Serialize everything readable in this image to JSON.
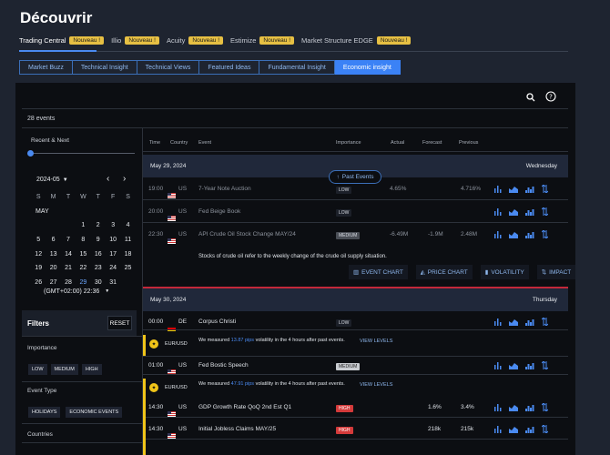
{
  "page": {
    "title": "Découvrir"
  },
  "topnav": [
    {
      "label": "Trading Central",
      "badge": "Nouveau !",
      "active": true
    },
    {
      "label": "Illio",
      "badge": "Nouveau !"
    },
    {
      "label": "Acuity",
      "badge": "Nouveau !"
    },
    {
      "label": "Estimize",
      "badge": "Nouveau !"
    },
    {
      "label": "Market Structure EDGE",
      "badge": "Nouveau !"
    }
  ],
  "subtabs": [
    "Market Buzz",
    "Technical Insight",
    "Technical Views",
    "Featured Ideas",
    "Fundamental Insight",
    "Economic insight"
  ],
  "events_count": "28 events",
  "sidebar": {
    "range_label": "Recent & Next",
    "month_label": "2024-05",
    "month_name": "MAY",
    "weekdays": [
      "S",
      "M",
      "T",
      "W",
      "T",
      "F",
      "S"
    ],
    "weeks": [
      [
        "",
        "",
        "",
        "1",
        "2",
        "3",
        "4"
      ],
      [
        "5",
        "6",
        "7",
        "8",
        "9",
        "10",
        "11"
      ],
      [
        "12",
        "13",
        "14",
        "15",
        "16",
        "17",
        "18"
      ],
      [
        "19",
        "20",
        "21",
        "22",
        "23",
        "24",
        "25"
      ],
      [
        "26",
        "27",
        "28",
        "29",
        "30",
        "31",
        ""
      ]
    ],
    "today": "29",
    "timezone": "(GMT+02:00) 22:36",
    "filters_title": "Filters",
    "reset_label": "RESET",
    "importance_label": "Importance",
    "importance_options": [
      "LOW",
      "MEDIUM",
      "HIGH"
    ],
    "event_type_label": "Event Type",
    "event_type_options": [
      "HOLIDAYS",
      "ECONOMIC EVENTS"
    ],
    "countries_label": "Countries"
  },
  "table": {
    "columns": [
      "Time",
      "Country",
      "Event",
      "Importance",
      "Actual",
      "Forecast",
      "Previous"
    ],
    "past_events_label": "Past Events",
    "day1": {
      "date": "May 29, 2024",
      "weekday": "Wednesday"
    },
    "day2": {
      "date": "May 30, 2024",
      "weekday": "Thursday"
    },
    "rows1": [
      {
        "time": "19:00",
        "country": "US",
        "event": "7-Year Note Auction",
        "importance": "LOW",
        "actual": "4.65%",
        "forecast": "",
        "previous": "4.716%",
        "dim": true
      },
      {
        "time": "20:00",
        "country": "US",
        "event": "Fed Beige Book",
        "importance": "LOW",
        "actual": "",
        "forecast": "",
        "previous": "",
        "dim": true
      },
      {
        "time": "22:30",
        "country": "US",
        "event": "API Crude Oil Stock Change MAY/24",
        "importance": "MEDIUM",
        "actual": "-6.49M",
        "forecast": "-1.9M",
        "previous": "2.48M",
        "dim": true
      }
    ],
    "expanded_text": "Stocks of crude oil refer to the weekly change of the crude oil supply situation.",
    "expanded_actions": [
      "EVENT CHART",
      "PRICE CHART",
      "VOLATILITY",
      "IMPACT"
    ],
    "rows2": [
      {
        "time": "00:00",
        "country": "DE",
        "event": "Corpus Christi",
        "importance": "LOW"
      },
      {
        "time": "01:00",
        "country": "US",
        "event": "Fed Bostic Speech",
        "importance": "MEDIUM"
      },
      {
        "time": "14:30",
        "country": "US",
        "event": "GDP Growth Rate QoQ 2nd Est Q1",
        "importance": "HIGH",
        "actual": "",
        "forecast": "1.6%",
        "previous": "3.4%"
      },
      {
        "time": "14:30",
        "country": "US",
        "event": "Initial Jobless Claims MAY/25",
        "importance": "HIGH",
        "actual": "",
        "forecast": "218k",
        "previous": "215k"
      }
    ],
    "notif1": {
      "pair": "EUR/USD",
      "pre": "We measured ",
      "pips": "13.87 pips",
      "post": " volatility in the 4 hours after past events.",
      "action": "VIEW LEVELS"
    },
    "notif2": {
      "pair": "EUR/USD",
      "pre": "We measured ",
      "pips": "47.91 pips",
      "post": " volatility in the 4 hours after past events.",
      "action": "VIEW LEVELS"
    }
  },
  "colors": {
    "accent": "#3b82f6",
    "badge": "#e7c043",
    "high": "#d43a3a",
    "highlight": "#f0c419"
  }
}
